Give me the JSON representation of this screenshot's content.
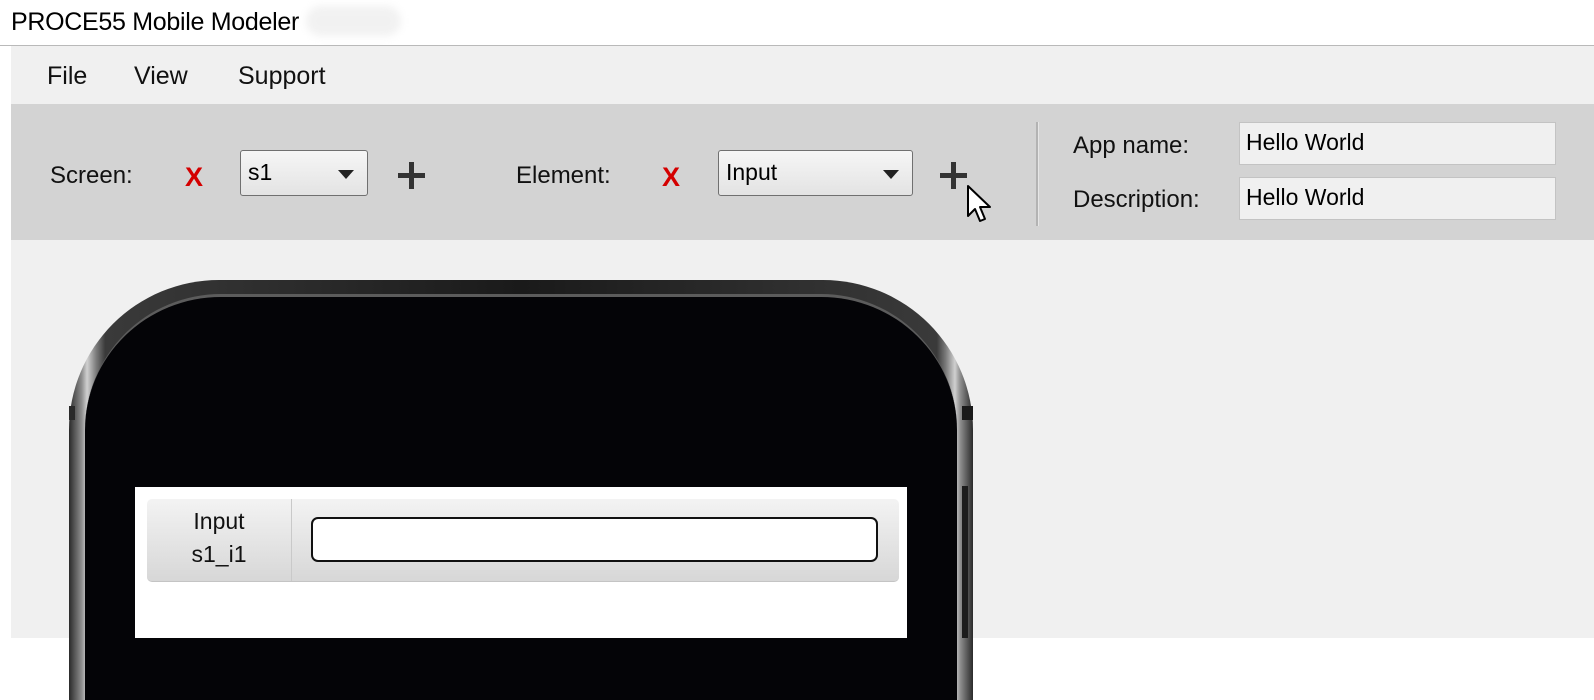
{
  "window": {
    "title": "PROCE55 Mobile Modeler"
  },
  "menu": {
    "items": [
      {
        "label": "File"
      },
      {
        "label": "View"
      },
      {
        "label": "Support"
      }
    ]
  },
  "toolbar": {
    "screen_label": "Screen:",
    "screen_delete_icon": "X",
    "screen_selected": "s1",
    "element_label": "Element:",
    "element_delete_icon": "X",
    "element_selected": "Input",
    "app_name_label": "App name:",
    "app_name_value": "Hello World",
    "description_label": "Description:",
    "description_value": "Hello World"
  },
  "preview": {
    "element_type": "Input",
    "element_id": "s1_i1",
    "input_value": ""
  },
  "icons": {
    "delete": "x-icon",
    "add": "plus-icon",
    "dropdown": "chevron-down-icon",
    "cursor": "mouse-pointer-icon"
  },
  "colors": {
    "delete_red": "#d40000",
    "toolbar_bg": "#d3d3d3",
    "window_bg": "#f0f0f0",
    "phone_body": "#040407"
  }
}
